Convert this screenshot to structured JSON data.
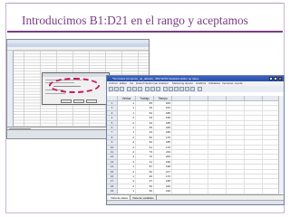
{
  "slide": {
    "title": "Introducimos B1:D21 en el rango y aceptamos",
    "accent_color": "#7b3b86",
    "highlight_color": "#c4165e"
  },
  "front_window": {
    "title": "*Sin título1 [Conjunto_de_datos0] - IBM SPSS Statistics Editor de datos",
    "menu": [
      "Archivo",
      "Editar",
      "Ver",
      "Datos",
      "Transformar",
      "Analizar",
      "Marketing directo",
      "Gráficos",
      "Utilidades",
      "Ventanas",
      "Ayuda"
    ],
    "columns": [
      "Ventas",
      "Trabajo",
      "Tiempo"
    ],
    "rows": [
      {
        "n": "1",
        "a": "1",
        "b": "65",
        "c": "184"
      },
      {
        "n": "2",
        "a": "1",
        "b": "33",
        "c": "163"
      },
      {
        "n": "3",
        "a": "1",
        "b": "64",
        "c": "186"
      },
      {
        "n": "4",
        "a": "2",
        "b": "33",
        "c": "195"
      },
      {
        "n": "5",
        "a": "2",
        "b": "43",
        "c": "185"
      },
      {
        "n": "6",
        "a": "1",
        "b": "45",
        "c": "183"
      },
      {
        "n": "7",
        "a": "1",
        "b": "44",
        "c": "180"
      },
      {
        "n": "8",
        "a": "2",
        "b": "52",
        "c": "176"
      },
      {
        "n": "9",
        "a": "2",
        "b": "62",
        "c": "185"
      },
      {
        "n": "10",
        "a": "2",
        "b": "41",
        "c": "170"
      },
      {
        "n": "11",
        "a": "2",
        "b": "73",
        "c": "219"
      },
      {
        "n": "12",
        "a": "3",
        "b": "72",
        "c": "200"
      },
      {
        "n": "13",
        "a": "3",
        "b": "11",
        "c": "190"
      },
      {
        "n": "14",
        "a": "1",
        "b": "87",
        "c": "198"
      },
      {
        "n": "15",
        "a": "2",
        "b": "52",
        "c": "217"
      },
      {
        "n": "16",
        "a": "1",
        "b": "46",
        "c": "170"
      },
      {
        "n": "17",
        "a": "3",
        "b": "37",
        "c": "198"
      },
      {
        "n": "18",
        "a": "2",
        "b": "50",
        "c": "182"
      },
      {
        "n": "19",
        "a": "1",
        "b": "60",
        "c": "192"
      },
      {
        "n": "20",
        "a": "3",
        "b": "67",
        "c": "183"
      }
    ],
    "tabs": [
      "Vista de datos",
      "Vista de variables"
    ]
  },
  "background_window": {
    "sheet_tabs": [
      "Hoja1",
      "Hoja2"
    ]
  }
}
